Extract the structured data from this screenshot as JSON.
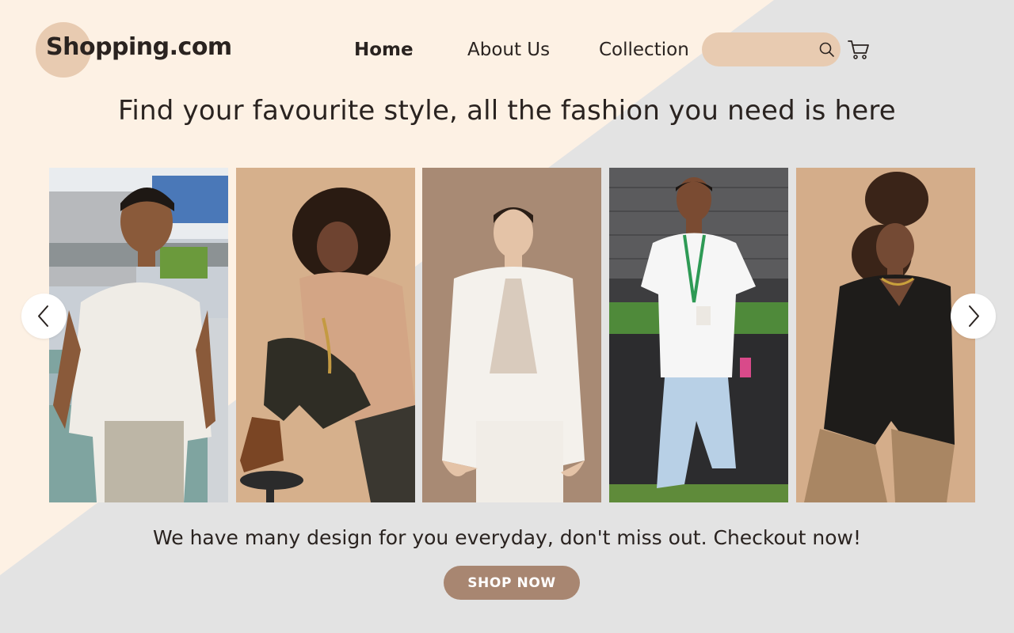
{
  "brand": {
    "name": "Shopping.com",
    "accent": "#e8cbb1",
    "button_color": "#a88671",
    "cream_bg": "#fdf1e4",
    "grey_bg": "#e3e3e3"
  },
  "nav": {
    "home": "Home",
    "about": "About Us",
    "collection": "Collection",
    "active": "Home"
  },
  "search": {
    "value": "",
    "placeholder": "",
    "icon": "search-icon"
  },
  "cart": {
    "icon": "cart-icon"
  },
  "hero": {
    "headline": "Find your favourite style, all the fashion you need is here"
  },
  "carousel": {
    "prev_icon": "chevron-left-icon",
    "next_icon": "chevron-right-icon",
    "photos": [
      {
        "alt": "Smiling man in white short-sleeve shirt and khaki pants"
      },
      {
        "alt": "Woman with curly hair in beige blazer posing on a stool"
      },
      {
        "alt": "Woman in white suit against brown backdrop"
      },
      {
        "alt": "Young man in white t-shirt with lanyard and light blue cargo pants"
      },
      {
        "alt": "Woman with curly updo in black jacket and tan pants"
      }
    ]
  },
  "cta": {
    "tagline": "We have many design for you everyday, don't miss out. Checkout now!",
    "button": "SHOP NOW"
  }
}
